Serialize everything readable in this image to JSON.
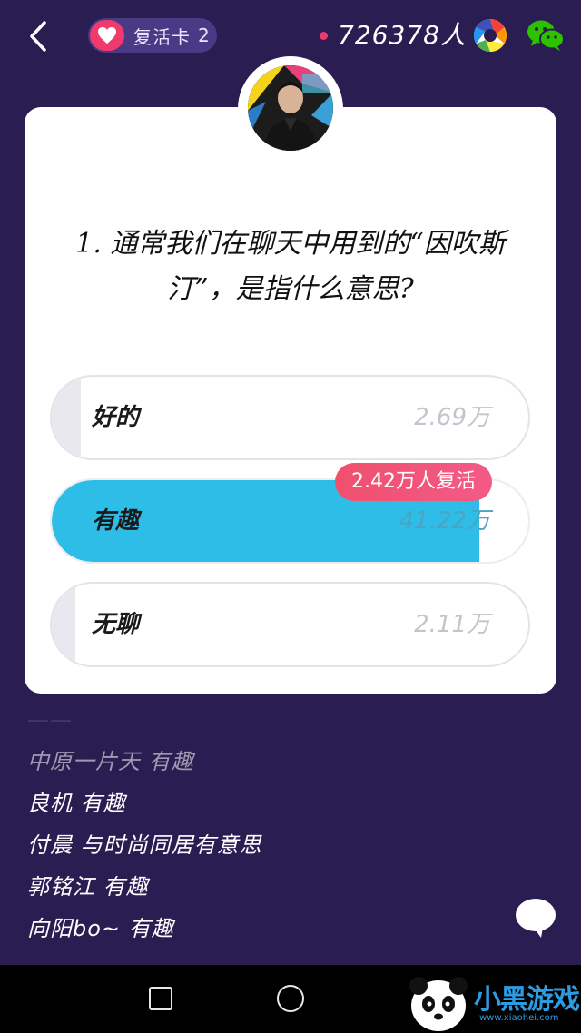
{
  "header": {
    "revive_card_label": "复活卡",
    "revive_card_count": "2",
    "online_count": "726378人"
  },
  "question": {
    "text": "1. 通常我们在聊天中用到的“因吹斯汀”，是指什么意思?"
  },
  "options": [
    {
      "label": "好的",
      "count": "2.69万",
      "fill_ratio": 0.06,
      "selected": false
    },
    {
      "label": "有趣",
      "count": "41.22万",
      "fill_ratio": 0.897,
      "selected": true
    },
    {
      "label": "无聊",
      "count": "2.11万",
      "fill_ratio": 0.05,
      "selected": false
    }
  ],
  "revived_badge": "2.42万人复活",
  "comments": [
    "中原一片天 有趣",
    "良机 有趣",
    "付晨 与时尚同居有意思",
    "郭铭江 有趣",
    "向阳bo~ 有趣"
  ],
  "watermark": {
    "brand": "小黑游戏",
    "url": "www.xiaohei.com"
  },
  "colors": {
    "background": "#2a1d52",
    "accent_pink": "#f03a6e",
    "selected_blue": "#2ebde6"
  }
}
